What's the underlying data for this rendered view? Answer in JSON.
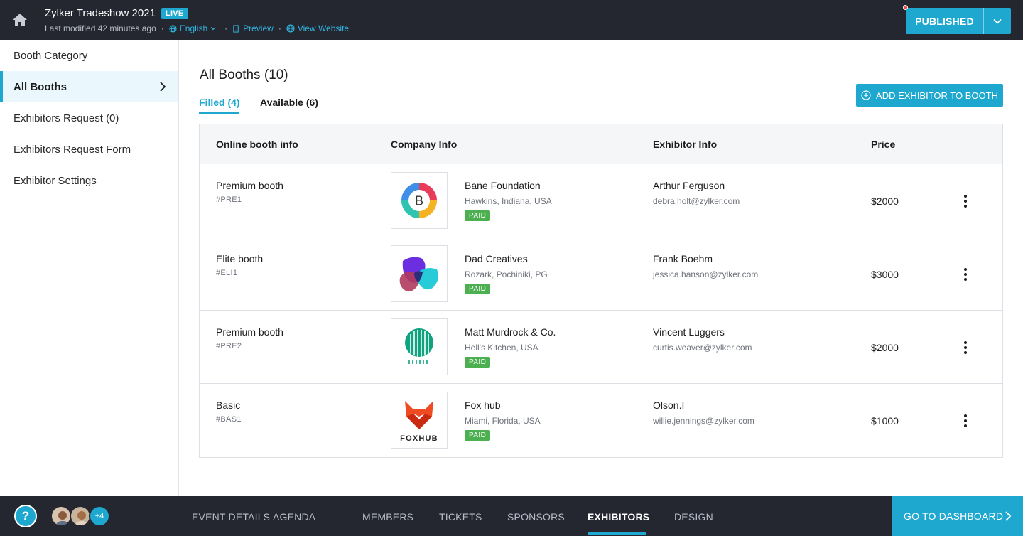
{
  "header": {
    "event_title": "Zylker Tradeshow 2021",
    "live_badge": "LIVE",
    "last_modified": "Last modified 42 minutes ago",
    "language": "English",
    "preview": "Preview",
    "view_website": "View Website",
    "publish_label": "PUBLISHED"
  },
  "sidebar": {
    "items": [
      {
        "label": "Booth Category"
      },
      {
        "label": "All Booths"
      },
      {
        "label": "Exhibitors Request (0)"
      },
      {
        "label": "Exhibitors Request Form"
      },
      {
        "label": "Exhibitor Settings"
      }
    ]
  },
  "main": {
    "title": "All Booths (10)",
    "tabs": [
      {
        "label": "Filled (4)"
      },
      {
        "label": "Available (6)"
      }
    ],
    "add_button": "ADD EXHIBITOR TO BOOTH",
    "columns": [
      "Online booth info",
      "Company Info",
      "Exhibitor Info",
      "Price"
    ],
    "rows": [
      {
        "booth": "Premium booth",
        "booth_id": "#PRE1",
        "company": "Bane Foundation",
        "location": "Hawkins, Indiana, USA",
        "status": "PAID",
        "exhibitor": "Arthur Ferguson",
        "email": "debra.holt@zylker.com",
        "price": "$2000",
        "logo": "B"
      },
      {
        "booth": "Elite booth",
        "booth_id": "#ELI1",
        "company": "Dad Creatives",
        "location": "Rozark, Pochiniki, PG",
        "status": "PAID",
        "exhibitor": "Frank Boehm",
        "email": "jessica.hanson@zylker.com",
        "price": "$3000"
      },
      {
        "booth": "Premium booth",
        "booth_id": "#PRE2",
        "company": "Matt Murdrock & Co.",
        "location": "Hell's Kitchen, USA",
        "status": "PAID",
        "exhibitor": "Vincent Luggers",
        "email": "curtis.weaver@zylker.com",
        "price": "$2000"
      },
      {
        "booth": "Basic",
        "booth_id": "#BAS1",
        "company": "Fox hub",
        "location": "Miami, Florida, USA",
        "status": "PAID",
        "exhibitor": "Olson.I",
        "email": "willie.jennings@zylker.com",
        "price": "$1000",
        "logo": "FOXHUB"
      }
    ]
  },
  "footer": {
    "help": "?",
    "more_members": "+4",
    "nav": [
      {
        "label": "EVENT DETAILS"
      },
      {
        "label": "AGENDA"
      },
      {
        "label": "MEMBERS"
      },
      {
        "label": "TICKETS"
      },
      {
        "label": "SPONSORS"
      },
      {
        "label": "EXHIBITORS"
      },
      {
        "label": "DESIGN"
      }
    ],
    "dashboard_button": "GO TO DASHBOARD"
  },
  "colors": {
    "accent": "#1ea7cf",
    "topbar": "#242630",
    "paid": "#4caf50"
  },
  "icons": [
    "home-icon",
    "globe-icon",
    "preview-icon",
    "chevron-down-icon",
    "chevron-right-icon",
    "plus-circle-icon",
    "more-vertical-icon",
    "help-icon"
  ]
}
